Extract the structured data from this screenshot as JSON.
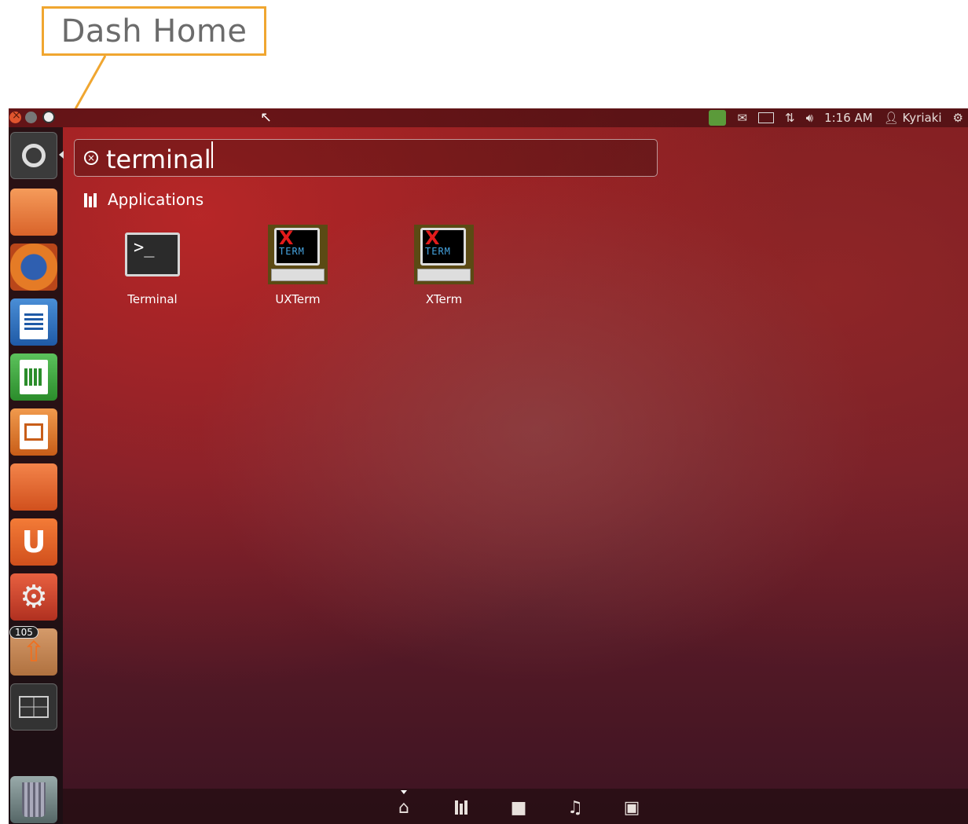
{
  "annotation": {
    "label": "Dash Home",
    "color": "#f0a630"
  },
  "topbar": {
    "clock": "1:16 AM",
    "user": "Kyriaki",
    "icons": [
      "update-manager-icon",
      "mail-icon",
      "keyboard-icon",
      "network-icon",
      "volume-icon",
      "session-gear-icon"
    ]
  },
  "search": {
    "query": "terminal"
  },
  "section": {
    "title": "Applications"
  },
  "apps": [
    {
      "name": "Terminal"
    },
    {
      "name": "UXTerm"
    },
    {
      "name": "XTerm"
    }
  ],
  "launcher": {
    "items": [
      "Dash Home",
      "Files",
      "Firefox",
      "LibreOffice Writer",
      "LibreOffice Calc",
      "LibreOffice Impress",
      "Ubuntu Software Center",
      "Ubuntu One",
      "System Settings",
      "Update Manager",
      "Workspace Switcher",
      "Trash"
    ],
    "update_badge": "105"
  },
  "filterbar": {
    "lenses": [
      "Home",
      "Applications",
      "Files",
      "Music",
      "Video"
    ]
  },
  "colors": {
    "accent": "#dd4814",
    "background": "#7a1a1e"
  }
}
